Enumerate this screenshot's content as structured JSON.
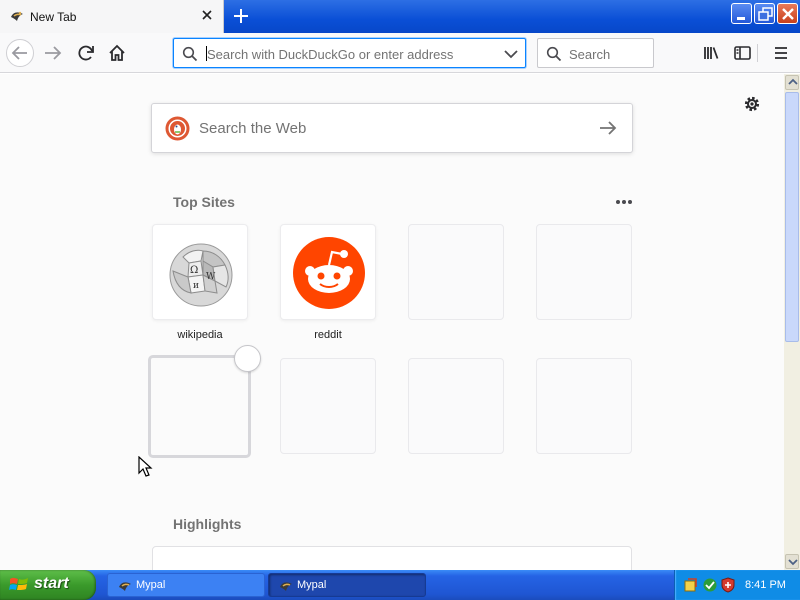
{
  "tab": {
    "title": "New Tab",
    "favicon": "mypal-icon"
  },
  "navbar": {
    "url_placeholder": "Search with DuckDuckGo or enter address",
    "search_placeholder": "Search"
  },
  "newtab": {
    "websearch_placeholder": "Search the Web",
    "top_sites_title": "Top Sites",
    "highlights_title": "Highlights",
    "top_sites": [
      {
        "label": "wikipedia",
        "icon": "wikipedia-icon"
      },
      {
        "label": "reddit",
        "icon": "reddit-icon",
        "color": "#ff4500"
      }
    ]
  },
  "taskbar": {
    "start_label": "start",
    "tasks": [
      {
        "label": "Mypal"
      },
      {
        "label": "Mypal"
      }
    ],
    "clock": "8:41 PM"
  },
  "colors": {
    "accent": "#0a84ff",
    "titlebar": "#0a4fd6",
    "reddit": "#ff4500",
    "duckduckgo": "#de5833"
  }
}
